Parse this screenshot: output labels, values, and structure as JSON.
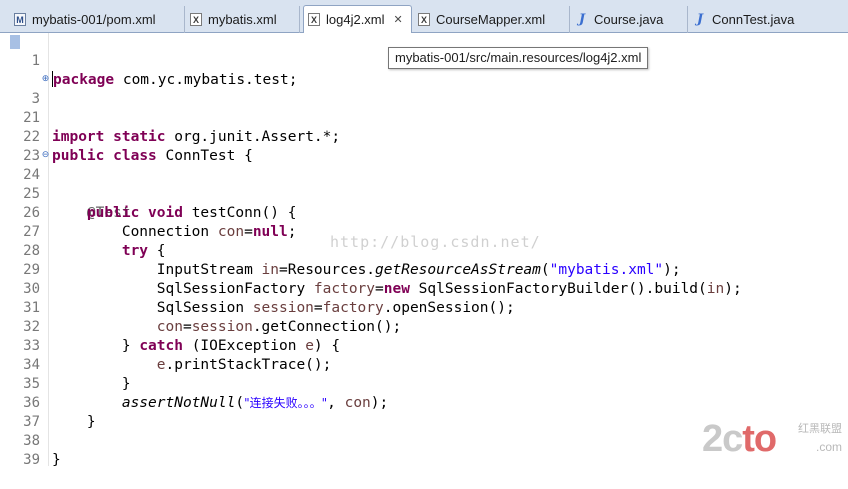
{
  "tabs": [
    {
      "label": "mybatis-001/pom.xml",
      "icon": "maven-pom-icon"
    },
    {
      "label": "mybatis.xml",
      "icon": "xml-file-icon"
    },
    {
      "label": "log4j2.xml",
      "icon": "xml-file-icon",
      "close": "✕"
    },
    {
      "label": "CourseMapper.xml",
      "icon": "xml-file-icon"
    },
    {
      "label": "Course.java",
      "icon": "java-file-icon"
    },
    {
      "label": "ConnTest.java",
      "icon": "java-file-icon"
    }
  ],
  "tooltip": "mybatis-001/src/main.resources/log4j2.xml",
  "watermark": "http://blog.csdn.net/",
  "logo": {
    "main_a": "2c",
    "main_b": "to",
    "cn": "红黑联盟",
    "domain": ".com"
  },
  "editor": {
    "lines": [
      {
        "n": "1"
      },
      {
        "n": "3"
      },
      {
        "n": "21"
      },
      {
        "n": "22"
      },
      {
        "n": "23"
      },
      {
        "n": "24"
      },
      {
        "n": "25"
      },
      {
        "n": "26"
      },
      {
        "n": "27"
      },
      {
        "n": "28"
      },
      {
        "n": "29"
      },
      {
        "n": "30"
      },
      {
        "n": "31"
      },
      {
        "n": "32"
      },
      {
        "n": "33"
      },
      {
        "n": "34"
      },
      {
        "n": "35"
      },
      {
        "n": "36"
      },
      {
        "n": "37"
      },
      {
        "n": "38"
      },
      {
        "n": "39"
      }
    ],
    "code": {
      "l1_kw": "package",
      "l1_rest": " com.yc.mybatis.test;",
      "l3_kw1": "import",
      "l3_kw2": "static",
      "l3_rest": " org.junit.Assert.*;",
      "l22_kw1": "public",
      "l22_kw2": "class",
      "l22_rest": " ConnTest {",
      "l24_ann": "@Test",
      "l25_kw1": "public",
      "l25_kw2": "void",
      "l25_rest": " testConn() {",
      "l26_type": "Connection ",
      "l26_var": "con",
      "l26_eq": "=",
      "l26_kw": "null",
      "l26_end": ";",
      "l27_kw": "try",
      "l27_rest": " {",
      "l28_type": "InputStream ",
      "l28_var": "in",
      "l28_eq": "=Resources.",
      "l28_call": "getResourceAsStream",
      "l28_open": "(",
      "l28_str": "\"mybatis.xml\"",
      "l28_end": ");",
      "l29_type": "SqlSessionFactory ",
      "l29_var": "factory",
      "l29_eq": "=",
      "l29_kw": "new",
      "l29_rest": " SqlSessionFactoryBuilder().build(",
      "l29_var2": "in",
      "l29_end": ");",
      "l30_type": "SqlSession ",
      "l30_var": "session",
      "l30_eq": "=",
      "l30_var2": "factory",
      "l30_rest": ".openSession();",
      "l31_var": "con",
      "l31_eq": "=",
      "l31_var2": "session",
      "l31_rest": ".getConnection();",
      "l32_pre": "} ",
      "l32_kw": "catch",
      "l32_mid": " (IOException ",
      "l32_var": "e",
      "l32_end": ") {",
      "l33_var": "e",
      "l33_rest": ".printStackTrace();",
      "l34": "}",
      "l35_call": "assertNotNull",
      "l35_open": "(",
      "l35_str": "\"连接失败。。。\"",
      "l35_mid": ", ",
      "l35_var": "con",
      "l35_end": ");",
      "l36": "}",
      "l38": "}"
    }
  }
}
